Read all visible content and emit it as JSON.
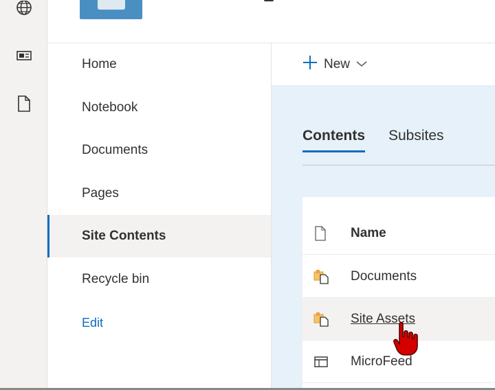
{
  "leftnav": {
    "items": [
      {
        "label": "Home"
      },
      {
        "label": "Notebook"
      },
      {
        "label": "Documents"
      },
      {
        "label": "Pages"
      },
      {
        "label": "Site Contents",
        "selected": true
      },
      {
        "label": "Recycle bin"
      }
    ],
    "edit_label": "Edit"
  },
  "appbar": {
    "icons": [
      "globe-icon",
      "news-icon",
      "document-icon"
    ]
  },
  "command_bar": {
    "new_label": "New"
  },
  "pivot": {
    "tabs": [
      {
        "label": "Contents",
        "active": true
      },
      {
        "label": "Subsites",
        "active": false
      }
    ]
  },
  "list": {
    "header_label": "Name",
    "rows": [
      {
        "name": "Documents",
        "icon": "library-icon"
      },
      {
        "name": "Site Assets",
        "icon": "library-icon",
        "hovered": true
      },
      {
        "name": "MicroFeed",
        "icon": "list-icon"
      }
    ]
  },
  "colors": {
    "accent": "#0f6cbd",
    "canvas_bg": "#e6f1f9",
    "library_icon": "#e8a33d",
    "cursor": "#d40000"
  }
}
